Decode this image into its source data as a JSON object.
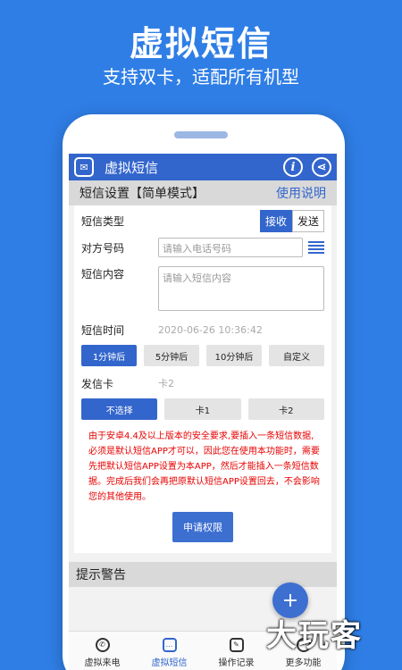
{
  "hero": {
    "title": "虚拟短信",
    "subtitle": "支持双卡，适配所有机型"
  },
  "appbar": {
    "title": "虚拟短信",
    "logo_icon": "sms-icon",
    "info_icon": "info-icon",
    "share_icon": "share-icon"
  },
  "mode_bar": {
    "title": "短信设置【简单模式】",
    "help_link": "使用说明"
  },
  "form": {
    "type_label": "短信类型",
    "type_options": [
      "接收",
      "发送"
    ],
    "type_selected": "接收",
    "number_label": "对方号码",
    "number_placeholder": "请输入电话号码",
    "content_label": "短信内容",
    "content_placeholder": "请输入短信内容",
    "time_label": "短信时间",
    "time_value": "2020-06-26 10:36:42",
    "time_options": [
      "1分钟后",
      "5分钟后",
      "10分钟后",
      "自定义"
    ],
    "time_selected": "1分钟后",
    "card_label": "发信卡",
    "card_value": "卡2",
    "card_options": [
      "不选择",
      "卡1",
      "卡2"
    ],
    "card_selected": "不选择"
  },
  "warning": {
    "text": "由于安卓4.4及以上版本的安全要求,要插入一条短信数据,必须是默认短信APP才可以，因此您在使用本功能时，需要先把默认短信APP设置为本APP，然后才能插入一条短信数据。完成后我们会再把原默认短信APP设置回去，不会影响您的其他使用。",
    "apply_button": "申请权限",
    "section_title": "提示警告"
  },
  "fab": "+",
  "tabs": [
    {
      "label": "虚拟来电",
      "icon": "phone-icon",
      "active": false
    },
    {
      "label": "虚拟短信",
      "icon": "message-icon",
      "active": true
    },
    {
      "label": "操作记录",
      "icon": "edit-icon",
      "active": false
    },
    {
      "label": "更多功能",
      "icon": "more-icon",
      "active": false
    }
  ],
  "watermark": "大玩客",
  "colors": {
    "background": "#2f7ee6",
    "primary": "#3366cc",
    "warning": "#e60000"
  }
}
